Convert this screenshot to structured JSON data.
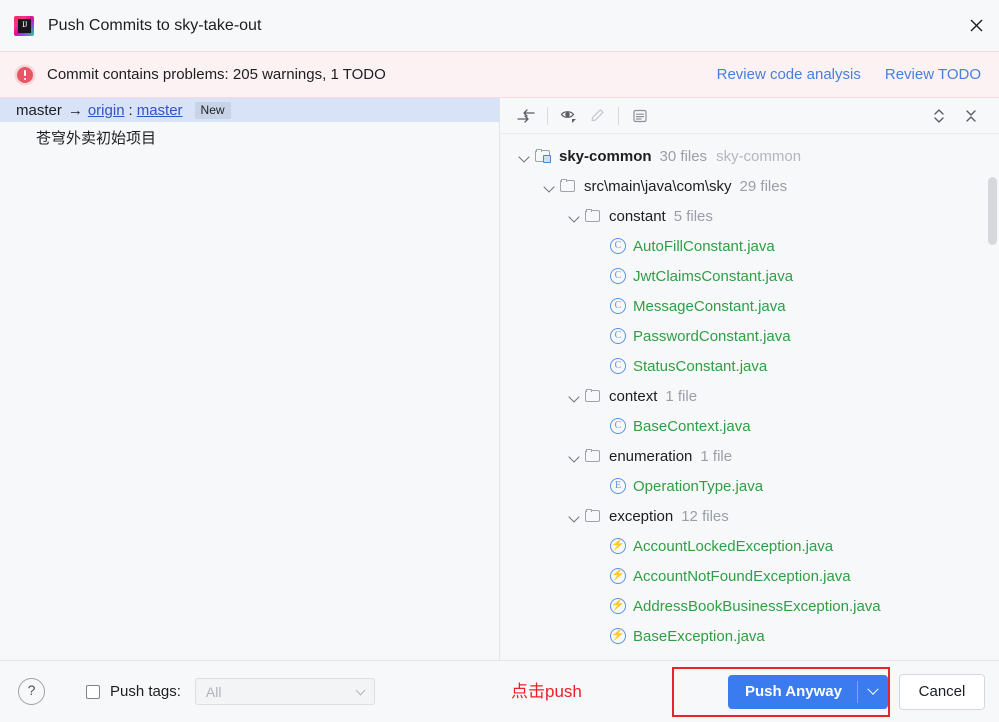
{
  "window": {
    "title": "Push Commits to sky-take-out",
    "app_icon": "intellij-idea-icon",
    "close_icon": "close-icon"
  },
  "banner": {
    "icon": "error-circle-icon",
    "message": "Commit contains problems: 205 warnings, 1 TODO",
    "links": [
      {
        "label": "Review code analysis"
      },
      {
        "label": "Review TODO"
      }
    ]
  },
  "left_pane": {
    "branch": {
      "local": "master",
      "arrow": "→",
      "remote": "origin",
      "separator": ":",
      "remote_branch": "master",
      "badge": "New"
    },
    "commit_message": "苍穹外卖初始项目"
  },
  "tree_toolbar": {
    "buttons": [
      {
        "name": "show-diff-icon",
        "glyph": "diff"
      },
      {
        "name": "preview-eye-icon",
        "glyph": "eye"
      },
      {
        "name": "edit-pencil-icon",
        "glyph": "pencil"
      },
      {
        "name": "group-by-icon",
        "glyph": "list"
      }
    ],
    "right_buttons": [
      {
        "name": "expand-all-icon",
        "glyph": "expand"
      },
      {
        "name": "collapse-all-icon",
        "glyph": "collapse"
      }
    ]
  },
  "tree": [
    {
      "type": "module",
      "indent": 0,
      "icon": "module-folder-icon",
      "name": "sky-common",
      "count": "30 files",
      "location": "sky-common",
      "expanded": true
    },
    {
      "type": "folder",
      "indent": 1,
      "icon": "folder-icon",
      "name": "src\\main\\java\\com\\sky",
      "count": "29 files",
      "expanded": true
    },
    {
      "type": "folder",
      "indent": 2,
      "icon": "folder-icon",
      "name": "constant",
      "count": "5 files",
      "expanded": true
    },
    {
      "type": "file",
      "indent": 3,
      "icon": "java-class-icon",
      "symbol": "C",
      "name": "AutoFillConstant.java"
    },
    {
      "type": "file",
      "indent": 3,
      "icon": "java-class-icon",
      "symbol": "C",
      "name": "JwtClaimsConstant.java"
    },
    {
      "type": "file",
      "indent": 3,
      "icon": "java-class-icon",
      "symbol": "C",
      "name": "MessageConstant.java"
    },
    {
      "type": "file",
      "indent": 3,
      "icon": "java-class-icon",
      "symbol": "C",
      "name": "PasswordConstant.java"
    },
    {
      "type": "file",
      "indent": 3,
      "icon": "java-class-icon",
      "symbol": "C",
      "name": "StatusConstant.java"
    },
    {
      "type": "folder",
      "indent": 2,
      "icon": "folder-icon",
      "name": "context",
      "count": "1 file",
      "expanded": true
    },
    {
      "type": "file",
      "indent": 3,
      "icon": "java-class-icon",
      "symbol": "C",
      "name": "BaseContext.java"
    },
    {
      "type": "folder",
      "indent": 2,
      "icon": "folder-icon",
      "name": "enumeration",
      "count": "1 file",
      "expanded": true
    },
    {
      "type": "file",
      "indent": 3,
      "icon": "java-enum-icon",
      "symbol": "E",
      "name": "OperationType.java"
    },
    {
      "type": "folder",
      "indent": 2,
      "icon": "folder-icon",
      "name": "exception",
      "count": "12 files",
      "expanded": true
    },
    {
      "type": "file",
      "indent": 3,
      "icon": "java-exception-icon",
      "symbol": "⚡",
      "name": "AccountLockedException.java"
    },
    {
      "type": "file",
      "indent": 3,
      "icon": "java-exception-icon",
      "symbol": "⚡",
      "name": "AccountNotFoundException.java"
    },
    {
      "type": "file",
      "indent": 3,
      "icon": "java-exception-icon",
      "symbol": "⚡",
      "name": "AddressBookBusinessException.java"
    },
    {
      "type": "file",
      "indent": 3,
      "icon": "java-exception-icon",
      "symbol": "⚡",
      "name": "BaseException.java"
    }
  ],
  "footer": {
    "help_label": "?",
    "push_tags_label": "Push tags:",
    "push_tags_checked": false,
    "tags_combo_value": "All",
    "annotation": "点击push",
    "push_button_label": "Push Anyway",
    "cancel_button_label": "Cancel"
  },
  "colors": {
    "accent_blue": "#3b7bf0",
    "link_blue": "#4a7ddb",
    "banner_bg": "#fdf2f3",
    "error_red": "#e55765",
    "annotation_red": "#ec1f26",
    "highlight_red": "#e8232a",
    "file_green": "#2f9e44",
    "selection_blue": "#d9e3f8"
  }
}
